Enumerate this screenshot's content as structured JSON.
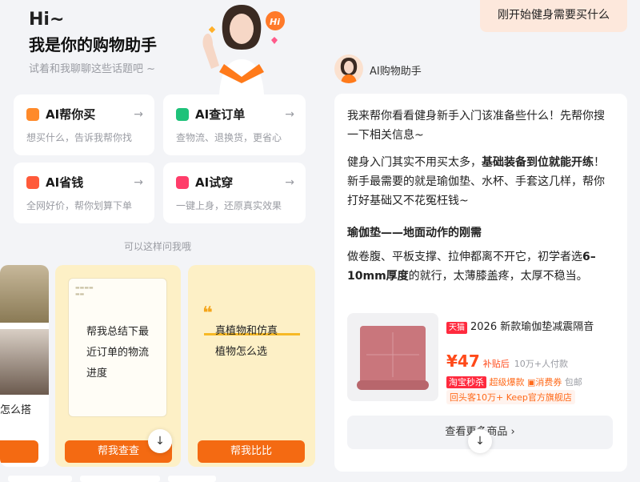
{
  "greeting": {
    "hi": "Hi~",
    "title": "我是你的购物助手",
    "subtitle": "试着和我聊聊这些话题吧 ~"
  },
  "features": [
    {
      "title": "AI帮你买",
      "desc": "想买什么，告诉我帮你找",
      "icon": "search-icon",
      "color": "#ff8a2a"
    },
    {
      "title": "AI查订单",
      "desc": "查物流、退换货，更省心",
      "icon": "box-icon",
      "color": "#1fc27a"
    },
    {
      "title": "AI省钱",
      "desc": "全网好价，帮你划算下单",
      "icon": "coupon-icon",
      "color": "#ff5a3a"
    },
    {
      "title": "AI试穿",
      "desc": "一键上身，还原真实效果",
      "icon": "shirt-icon",
      "color": "#ff3d6a"
    }
  ],
  "hint": "可以这样问我哦",
  "prompt_cards": [
    {
      "text_lines": [
        "帮我总结下最",
        "近订单的物流",
        "进度"
      ],
      "button": "帮我查查"
    },
    {
      "text_lines": [
        "真植物和仿真",
        "植物怎么选"
      ],
      "button": "帮我比比"
    }
  ],
  "partial_card": {
    "text": "怎么搭"
  },
  "user_message": "刚开始健身需要买什么",
  "assistant": {
    "name": "AI购物助手"
  },
  "chat": {
    "p1": "我来帮你看看健身新手入门该准备些什么！先帮你搜一下相关信息~",
    "p2a": "健身入门其实不用买太多，",
    "p2b": "基础装备到位就能开练",
    "p2c": "！新手最需要的就是瑜伽垫、水杯、手套这几样，帮你打好基础又不花冤枉钱~",
    "h3": "瑜伽垫——地面动作的刚需",
    "p4a": "做卷腹、平板支撑、拉伸都离不开它，初学者选",
    "p4b": "6–10mm厚度",
    "p4c": "的就行，太薄膝盖疼，太厚不稳当。"
  },
  "product": {
    "badge": "天猫",
    "title": "2026 新款瑜伽垫减震隔音",
    "price": "¥47",
    "price_suffix": "补贴后",
    "paid": "10万+人付款",
    "promo_badge": "淘宝秒杀",
    "promo_1": "超级爆款",
    "promo_2": "消费券",
    "promo_3": "包邮",
    "shop": "回头客10万+ Keep官方旗舰店"
  },
  "more_button": "查看更多商品",
  "colors": {
    "accent": "#f46a12",
    "price": "#ff4a1a",
    "tmall": "#ff2a3e"
  }
}
